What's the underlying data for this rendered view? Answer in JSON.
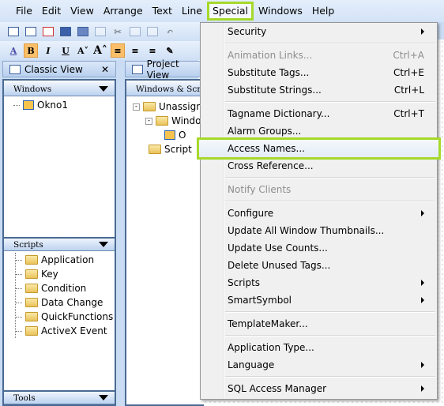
{
  "menubar": [
    "File",
    "Edit",
    "View",
    "Arrange",
    "Text",
    "Line",
    "Special",
    "Windows",
    "Help"
  ],
  "classic_view": {
    "title": "Classic View",
    "close": "✕",
    "windows": {
      "header": "Windows",
      "items": [
        "Okno1"
      ]
    },
    "scripts": {
      "header": "Scripts",
      "items": [
        "Application",
        "Key",
        "Condition",
        "Data Change",
        "QuickFunctions",
        "ActiveX Event"
      ]
    },
    "tools": {
      "header": "Tools"
    }
  },
  "project_view": {
    "title": "Project View",
    "header": "Windows & Scrip",
    "tree": [
      "Unassign",
      "Windo",
      "O",
      "Script"
    ]
  },
  "toolbar2": {
    "bold": "B",
    "italic": "I",
    "underline": "U",
    "font": "A"
  },
  "special_menu": [
    {
      "label": "Security",
      "submenu": true
    },
    {
      "sep": true
    },
    {
      "label": "Animation Links...",
      "shortcut": "Ctrl+A",
      "disabled": true
    },
    {
      "label": "Substitute Tags...",
      "shortcut": "Ctrl+E"
    },
    {
      "label": "Substitute Strings...",
      "shortcut": "Ctrl+L"
    },
    {
      "sep": true
    },
    {
      "label": "Tagname Dictionary...",
      "shortcut": "Ctrl+T"
    },
    {
      "label": "Alarm Groups..."
    },
    {
      "label": "Access Names...",
      "highlighted": true
    },
    {
      "label": "Cross Reference..."
    },
    {
      "sep": true
    },
    {
      "label": "Notify Clients",
      "disabled": true
    },
    {
      "sep": true
    },
    {
      "label": "Configure",
      "submenu": true
    },
    {
      "label": "Update All Window Thumbnails..."
    },
    {
      "label": "Update Use Counts..."
    },
    {
      "label": "Delete Unused Tags..."
    },
    {
      "label": "Scripts",
      "submenu": true
    },
    {
      "label": "SmartSymbol",
      "submenu": true
    },
    {
      "sep": true
    },
    {
      "label": "TemplateMaker..."
    },
    {
      "sep": true
    },
    {
      "label": "Application Type..."
    },
    {
      "label": "Language",
      "submenu": true
    },
    {
      "sep": true
    },
    {
      "label": "SQL Access Manager",
      "submenu": true
    }
  ],
  "colors": {
    "highlight": "#a6d92a",
    "panel_border": "#4a6a93"
  }
}
